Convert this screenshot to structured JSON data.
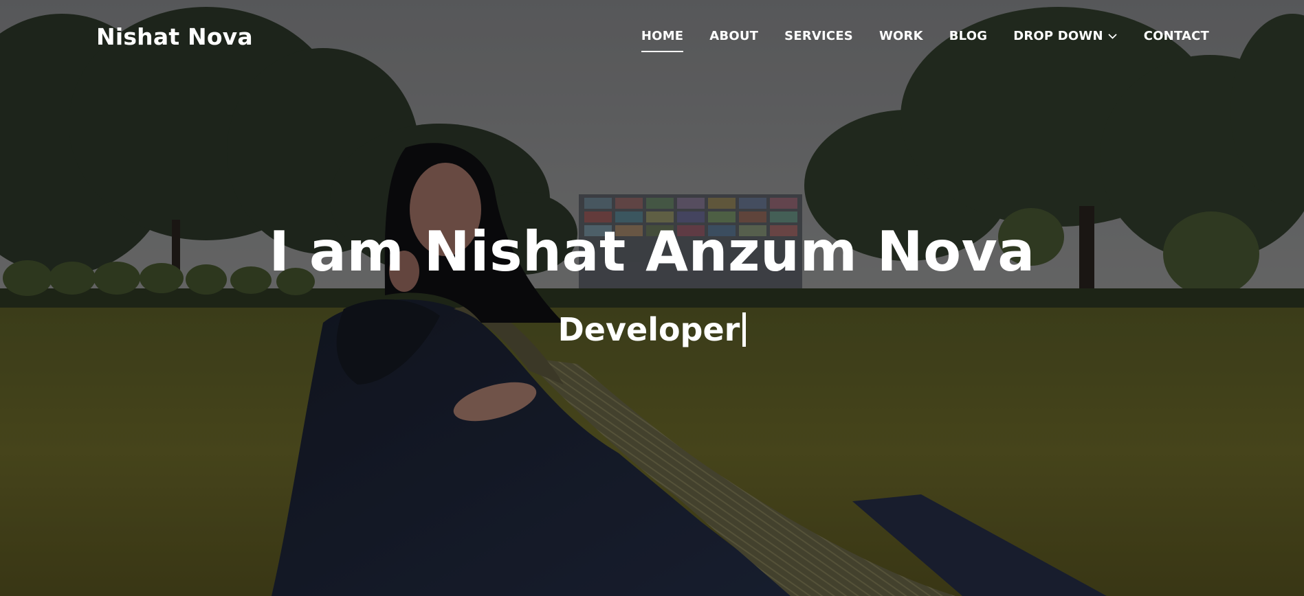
{
  "brand": "Nishat Nova",
  "nav": {
    "items": [
      {
        "label": "HOME",
        "active": true
      },
      {
        "label": "ABOUT",
        "active": false
      },
      {
        "label": "SERVICES",
        "active": false
      },
      {
        "label": "WORK",
        "active": false
      },
      {
        "label": "BLOG",
        "active": false
      },
      {
        "label": "DROP DOWN",
        "active": false,
        "icon": "chevron-down-icon"
      },
      {
        "label": "CONTACT",
        "active": false
      }
    ]
  },
  "hero": {
    "title": "I am Nishat Anzum Nova",
    "typed_text": "Developer"
  },
  "colors": {
    "text": "#ffffff",
    "sky": "#8e9093",
    "grass": "#6b6a2e",
    "saree": "#1c2433",
    "saree_border": "#6e6a4b"
  }
}
